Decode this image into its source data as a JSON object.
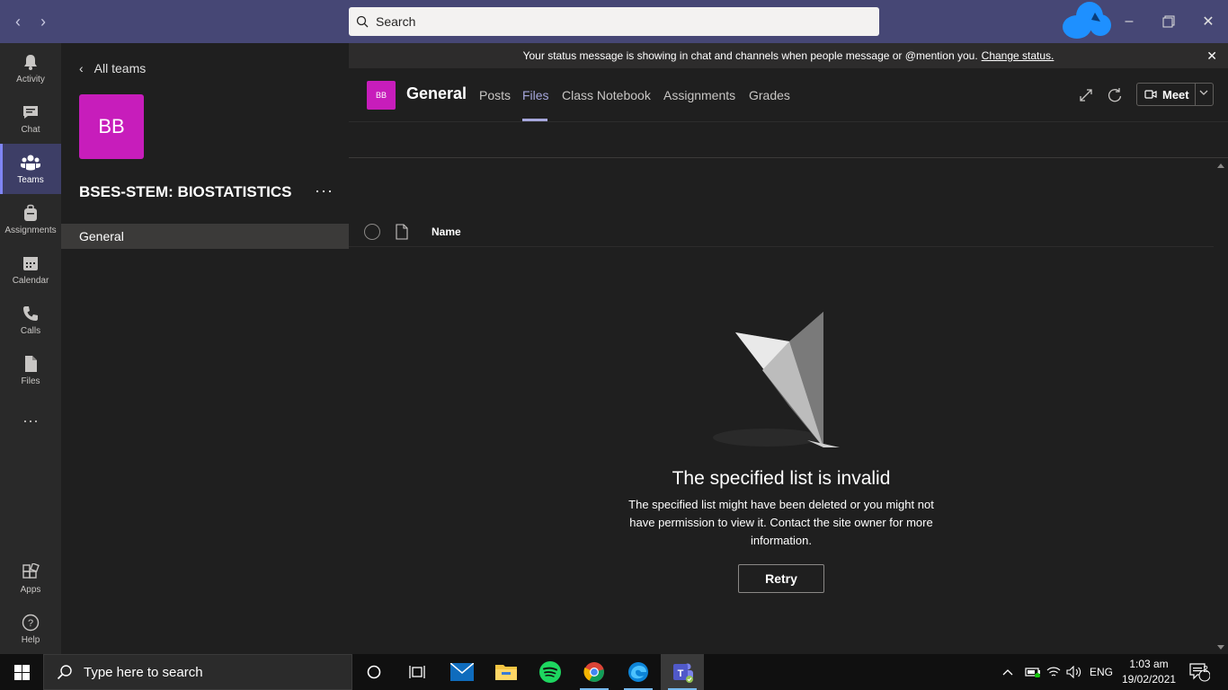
{
  "titlebar": {
    "search_placeholder": "Search"
  },
  "rail": {
    "items": [
      {
        "label": "Activity",
        "icon": "bell-icon"
      },
      {
        "label": "Chat",
        "icon": "chat-icon"
      },
      {
        "label": "Teams",
        "icon": "teams-icon"
      },
      {
        "label": "Assignments",
        "icon": "backpack-icon"
      },
      {
        "label": "Calendar",
        "icon": "calendar-icon"
      },
      {
        "label": "Calls",
        "icon": "phone-icon"
      },
      {
        "label": "Files",
        "icon": "file-icon"
      }
    ],
    "more": "···",
    "apps": "Apps",
    "help": "Help"
  },
  "panel": {
    "back_label": "All teams",
    "team_initials": "BB",
    "team_name": "BSES-STEM: BIOSTATISTICS",
    "more": "···",
    "channels": [
      "General"
    ]
  },
  "banner": {
    "text": "Your status message is showing in chat and channels when people message or @mention you.",
    "link": "Change status."
  },
  "channel_header": {
    "initials": "BB",
    "title": "General",
    "tabs": [
      "Posts",
      "Files",
      "Class Notebook",
      "Assignments",
      "Grades"
    ],
    "active_tab": "Files",
    "meet_label": "Meet"
  },
  "files": {
    "column_name": "Name",
    "error_title": "The specified list is invalid",
    "error_body": "The specified list might have been deleted or you might not have permission to view it. Contact the site owner for more information.",
    "retry_label": "Retry"
  },
  "taskbar": {
    "search_placeholder": "Type here to search",
    "language": "ENG",
    "time": "1:03 am",
    "date": "19/02/2021",
    "notification_count": "2"
  },
  "colors": {
    "titlebar": "#464775",
    "accent": "#a6a7dc",
    "team_avatar": "#c71dbb"
  }
}
